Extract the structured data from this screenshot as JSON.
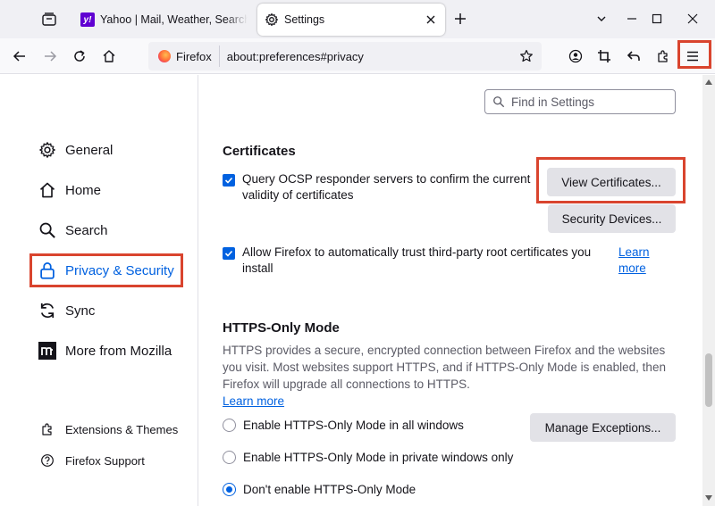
{
  "tabs": [
    {
      "title": "Yahoo | Mail, Weather, Search, Politics"
    },
    {
      "title": "Settings"
    }
  ],
  "navbar": {
    "identity_label": "Firefox",
    "url": "about:preferences#privacy"
  },
  "search": {
    "placeholder": "Find in Settings"
  },
  "sidebar": {
    "categories": [
      {
        "label": "General"
      },
      {
        "label": "Home"
      },
      {
        "label": "Search"
      },
      {
        "label": "Privacy & Security"
      },
      {
        "label": "Sync"
      },
      {
        "label": "More from Mozilla"
      }
    ],
    "footer": [
      {
        "label": "Extensions & Themes"
      },
      {
        "label": "Firefox Support"
      }
    ]
  },
  "certificates": {
    "heading": "Certificates",
    "ocsp_line1": "Query OCSP responder servers to confirm the current",
    "ocsp_line2": "validity of certificates",
    "view_button": "View Certificates...",
    "devices_button": "Security Devices...",
    "trust_line1": "Allow Firefox to automatically trust third-party root certificates you",
    "trust_line2": "install",
    "learn_more_1": "Learn",
    "learn_more_2": "more"
  },
  "https_only": {
    "heading": "HTTPS-Only Mode",
    "description_1": "HTTPS provides a secure, encrypted connection between Firefox and the websites",
    "description_2": "you visit. Most websites support HTTPS, and if HTTPS-Only Mode is enabled, then",
    "description_3": "Firefox will upgrade all connections to HTTPS.",
    "learn_more": "Learn more",
    "manage_button": "Manage Exceptions...",
    "options": [
      {
        "label": "Enable HTTPS-Only Mode in all windows",
        "selected": false
      },
      {
        "label": "Enable HTTPS-Only Mode in private windows only",
        "selected": false
      },
      {
        "label": "Don't enable HTTPS-Only Mode",
        "selected": true
      }
    ]
  },
  "colors": {
    "accent": "#0061e0",
    "highlight": "#d9442e",
    "button_bg": "#e2e2e7"
  }
}
